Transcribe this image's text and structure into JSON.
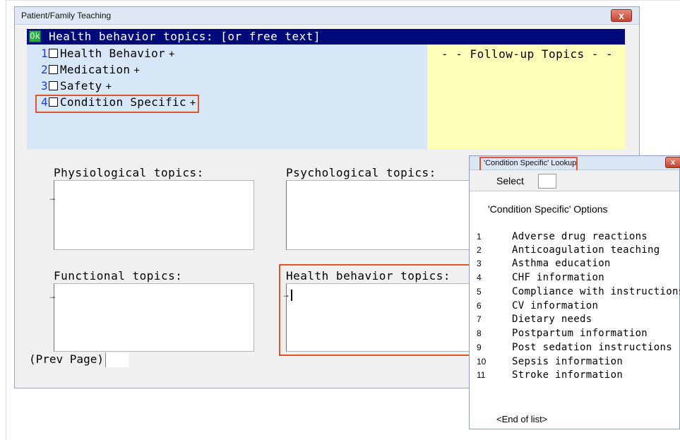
{
  "main_window": {
    "title": "Patient/Family Teaching",
    "close_label": "x",
    "ok_label": "Ok",
    "header": "Health behavior topics: [or free text]",
    "followup_title": "- - Follow-up Topics - -"
  },
  "options": [
    {
      "num": "1",
      "label": "Health Behavior",
      "suffix": "+"
    },
    {
      "num": "2",
      "label": "Medication",
      "suffix": "+"
    },
    {
      "num": "3",
      "label": "Safety",
      "suffix": "+"
    },
    {
      "num": "4",
      "label": "Condition Specific",
      "suffix": "+"
    }
  ],
  "sections": {
    "physiological": "Physiological topics:",
    "psychological": "Psychological topics:",
    "functional": "Functional topics:",
    "health_behavior": "Health behavior topics:",
    "arrow": "→"
  },
  "prev_page": "(Prev Page)",
  "lookup": {
    "title": "'Condition Specific' Lookup",
    "close_label": "x",
    "select_label": "Select",
    "options_title": "'Condition Specific' Options",
    "items": [
      {
        "num": "1",
        "label": "Adverse drug reactions"
      },
      {
        "num": "2",
        "label": "Anticoagulation teaching"
      },
      {
        "num": "3",
        "label": "Asthma education"
      },
      {
        "num": "4",
        "label": "CHF information"
      },
      {
        "num": "5",
        "label": "Compliance with instructions"
      },
      {
        "num": "6",
        "label": "CV information"
      },
      {
        "num": "7",
        "label": "Dietary needs"
      },
      {
        "num": "8",
        "label": "Postpartum information"
      },
      {
        "num": "9",
        "label": "Post sedation instructions"
      },
      {
        "num": "10",
        "label": "Sepsis information"
      },
      {
        "num": "11",
        "label": "Stroke information"
      }
    ],
    "end_of_list": "<End of list>"
  },
  "colors": {
    "header_bar": "#000a78",
    "form_bg": "#d7e7f7",
    "followup_bg": "#ffffb9",
    "highlight": "#e0542c",
    "option_number": "#1740d8",
    "ok_button": "#2fa843"
  }
}
